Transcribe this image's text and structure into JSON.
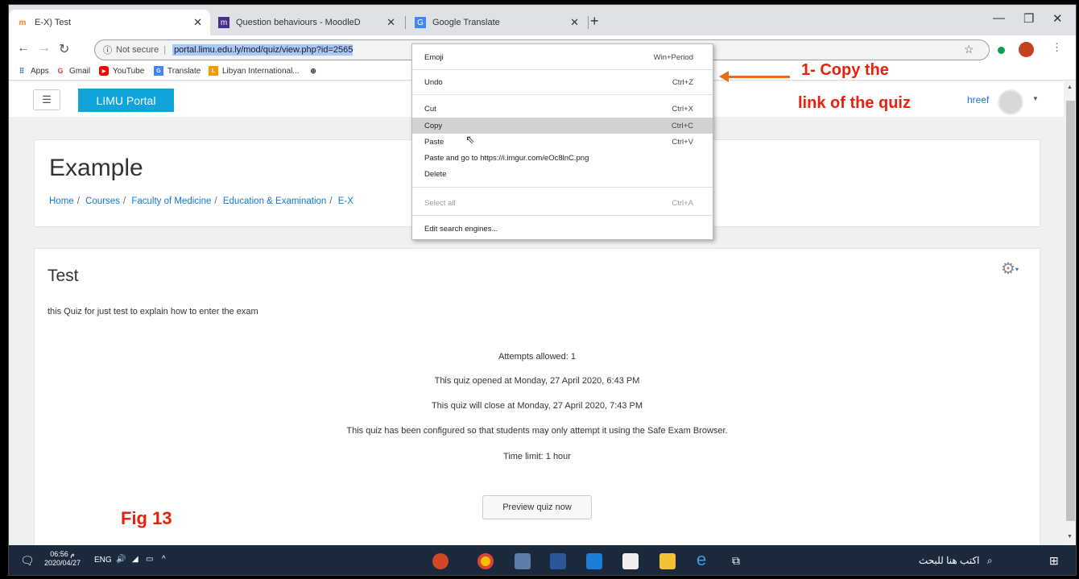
{
  "browser": {
    "tabs": [
      {
        "title": "E-X) Test",
        "favicon": "moodle-icon"
      },
      {
        "title": "Question behaviours - MoodleD",
        "favicon": "moodle-docs-icon"
      },
      {
        "title": "Google Translate",
        "favicon": "translate-icon"
      }
    ],
    "omnibox": {
      "security": "Not secure",
      "url": "portal.limu.edu.ly/mod/quiz/view.php?id=2565"
    },
    "bookmarks": [
      "Apps",
      "Gmail",
      "YouTube",
      "Translate",
      "Libyan International..."
    ]
  },
  "context_menu": {
    "items": [
      {
        "label": "Emoji",
        "shortcut": "Win+Period"
      },
      {
        "label": "Undo",
        "shortcut": "Ctrl+Z"
      },
      {
        "label": "Cut",
        "shortcut": "Ctrl+X"
      },
      {
        "label": "Copy",
        "shortcut": "Ctrl+C"
      },
      {
        "label": "Paste",
        "shortcut": "Ctrl+V"
      },
      {
        "label": "Paste and go to https://i.imgur.com/eOc8lnC.png",
        "shortcut": ""
      },
      {
        "label": "Delete",
        "shortcut": ""
      },
      {
        "label": "Select all",
        "shortcut": "Ctrl+A"
      },
      {
        "label": "Edit search engines...",
        "shortcut": ""
      }
    ]
  },
  "page": {
    "brand": "LIMU Portal",
    "user_name": "hreef",
    "course_title": "Example",
    "breadcrumb": [
      "Home",
      "Courses",
      "Faculty of Medicine",
      "Education & Examination",
      "E-X"
    ],
    "quiz_title": "Test",
    "quiz_description": "this Quiz for just test to explain how to enter the exam",
    "quiz_info": [
      "Attempts allowed: 1",
      "This quiz opened at Monday, 27 April 2020, 6:43 PM",
      "This quiz will close at Monday, 27 April 2020, 7:43 PM",
      "This quiz has been configured so that students may only attempt it using the Safe Exam Browser.",
      "Time limit: 1 hour"
    ],
    "preview_button": "Preview quiz now"
  },
  "annotations": {
    "step_line1": "1- Copy the",
    "step_line2": "link of the quiz",
    "figure_label": "Fig 13"
  },
  "taskbar": {
    "time": "06:56 م",
    "date": "2020/04/27",
    "language": "ENG",
    "search_placeholder": "اكتب هنا للبحث"
  },
  "colors": {
    "brand": "#11a4dc",
    "link": "#1177d1",
    "annotation_red": "#e8200d",
    "annotation_arrow": "#e66e18",
    "taskbar": "#1a2a3c"
  }
}
